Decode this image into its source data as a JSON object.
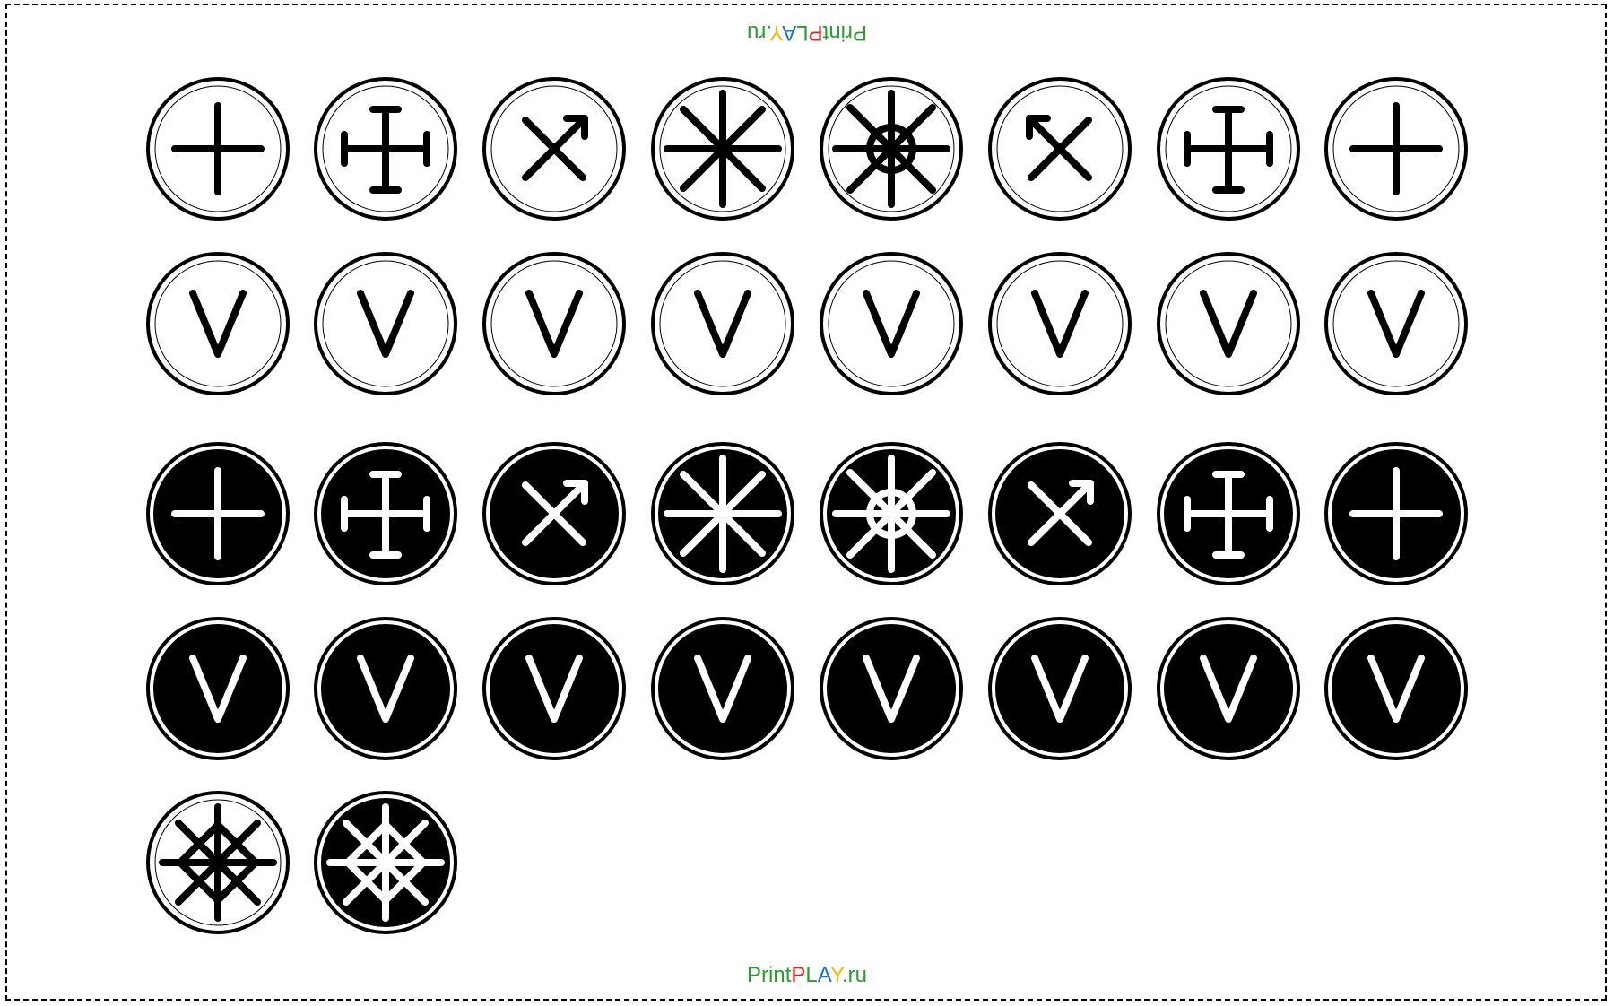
{
  "brand": {
    "parts": [
      {
        "text": "Print",
        "color": "#2e9b32"
      },
      {
        "text": "P",
        "color": "#e0261d"
      },
      {
        "text": "L",
        "color": "#2e9b32"
      },
      {
        "text": "A",
        "color": "#1f73c8"
      },
      {
        "text": "Y",
        "color": "#f2b90c"
      },
      {
        "text": ".ru",
        "color": "#2e9b32"
      }
    ]
  },
  "sheet": {
    "rows": [
      {
        "style": "white",
        "symbols": [
          "plus",
          "anchor-cross",
          "arrow-x-right",
          "asterisk-8",
          "wheel",
          "arrow-x-left",
          "anchor-cross",
          "plus"
        ]
      },
      {
        "style": "white",
        "symbols": [
          "v",
          "v",
          "v",
          "v",
          "v",
          "v",
          "v",
          "v"
        ]
      },
      {
        "style": "black",
        "symbols": [
          "plus",
          "anchor-cross",
          "arrow-x-right",
          "asterisk-8",
          "wheel",
          "arrow-x-right",
          "anchor-cross",
          "plus"
        ]
      },
      {
        "style": "black",
        "symbols": [
          "v",
          "v",
          "v",
          "v",
          "v",
          "v",
          "v",
          "v"
        ]
      },
      {
        "style": "mixed",
        "symbols": [
          "net-star",
          "net-star"
        ],
        "styles": [
          "white",
          "black"
        ]
      }
    ]
  }
}
